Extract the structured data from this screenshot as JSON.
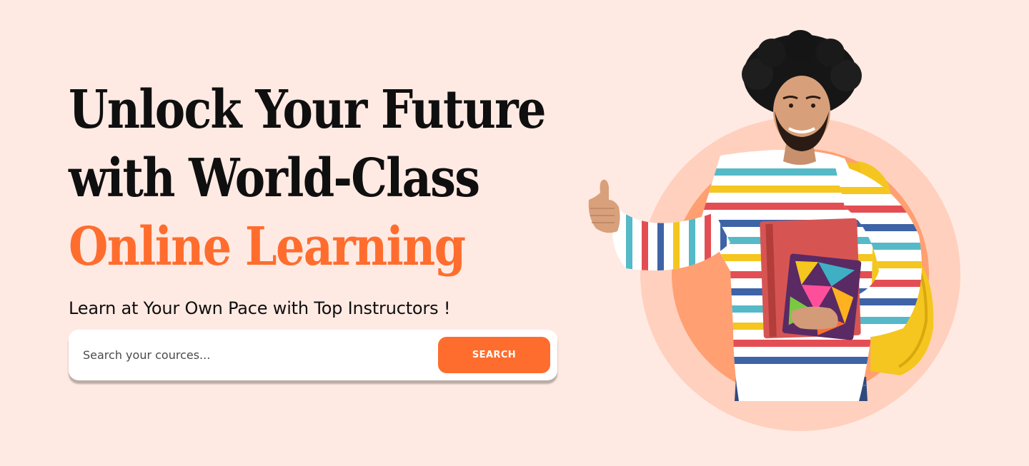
{
  "hero": {
    "headline": {
      "line1": "Unlock Your Future",
      "line2": "with World-Class",
      "line3": "Online Learning"
    },
    "subtitle": "Learn at Your Own Pace with Top Instructors !",
    "search": {
      "placeholder": "Search your cources...",
      "value": "",
      "button_label": "SEARCH"
    }
  },
  "illustration": {
    "subject": "student-with-books-thumbs-up",
    "icon": "student-photo"
  },
  "colors": {
    "background": "#ffeae3",
    "accent": "#ff6d2e",
    "headline": "#0f0f0f",
    "ring_outer": "#ffd0bd",
    "ring_inner": "#ff9f72"
  }
}
